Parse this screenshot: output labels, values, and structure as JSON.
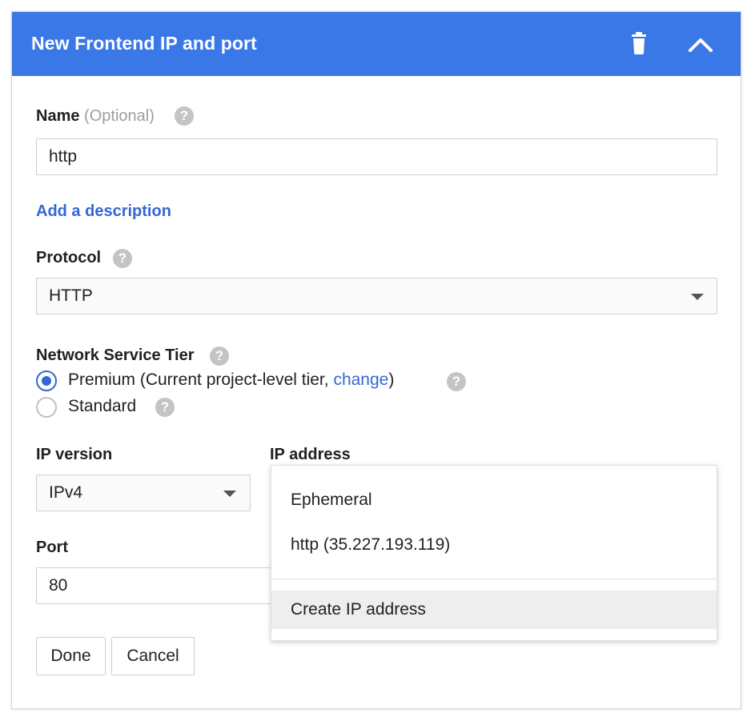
{
  "header": {
    "title": "New Frontend IP and port",
    "delete_icon": "trash-icon",
    "collapse_icon": "chevron-up-icon",
    "bg_color": "#3b78e7"
  },
  "name_field": {
    "label": "Name",
    "optional": "(Optional)",
    "value": "http"
  },
  "add_description": "Add a description",
  "protocol": {
    "label": "Protocol",
    "selected": "HTTP"
  },
  "network_tier": {
    "label": "Network Service Tier",
    "options": [
      {
        "label_prefix": "Premium (Current project-level tier, ",
        "link": "change",
        "label_suffix": ")",
        "checked": true
      },
      {
        "label": "Standard",
        "checked": false
      }
    ]
  },
  "ip_version": {
    "label": "IP version",
    "selected": "IPv4"
  },
  "ip_address": {
    "label": "IP address",
    "options": [
      "Ephemeral",
      "http (35.227.193.119)"
    ],
    "action": "Create IP address"
  },
  "port": {
    "label": "Port",
    "value": "80"
  },
  "buttons": {
    "done": "Done",
    "cancel": "Cancel"
  },
  "help_icon": "?",
  "accent_color": "#3367d6"
}
